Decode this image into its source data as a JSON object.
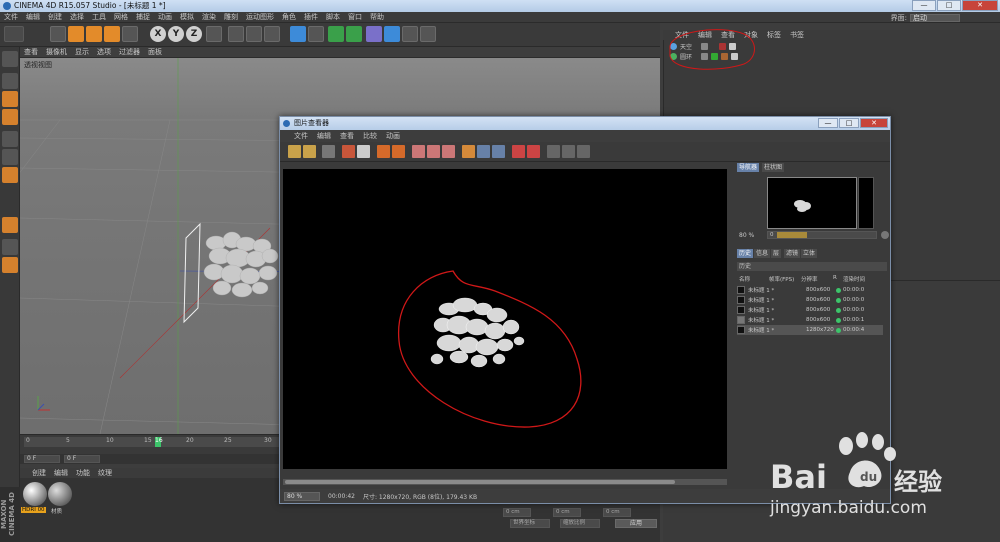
{
  "app": {
    "title": "CINEMA 4D R15.057 Studio - [未标题 1 *]",
    "window_buttons": [
      "—",
      "□",
      "✕"
    ]
  },
  "main_menu": [
    "文件",
    "编辑",
    "创建",
    "选择",
    "工具",
    "网格",
    "捕捉",
    "动画",
    "模拟",
    "渲染",
    "雕刻",
    "运动图形",
    "角色",
    "插件",
    "脚本",
    "窗口",
    "帮助"
  ],
  "layout": {
    "label": "界面:",
    "value": "启动"
  },
  "viewport": {
    "menu": [
      "查看",
      "摄像机",
      "显示",
      "选项",
      "过滤器",
      "面板"
    ],
    "label": "透视视图"
  },
  "timeline": {
    "ticks": [
      "0",
      "5",
      "10",
      "15",
      "16",
      "20",
      "25",
      "30"
    ],
    "current_frame": "16",
    "frame_start": "0 F",
    "frame_field": "0 F"
  },
  "material_manager": {
    "menu": [
      "创建",
      "编辑",
      "功能",
      "纹理"
    ],
    "materials": [
      {
        "label": "HDRI 00",
        "color": "#e8a21c"
      },
      {
        "label": "材质",
        "color": "#9a9a9a"
      }
    ],
    "brand": "MAXON CINEMA 4D"
  },
  "object_manager": {
    "menu": [
      "文件",
      "编辑",
      "查看",
      "对象",
      "标签",
      "书签"
    ],
    "objects": [
      {
        "name": "天空",
        "icon_color": "#5aa0e0"
      },
      {
        "name": "圆环",
        "icon_color": "#4cb060"
      }
    ]
  },
  "attributes": {
    "fields": [
      "0 cm",
      "0 cm",
      "0 cm"
    ],
    "coord_select": "世界坐标",
    "scale_select": "缩放比例",
    "apply": "应用"
  },
  "picture_viewer": {
    "title": "图片查看器",
    "menu": [
      "文件",
      "编辑",
      "查看",
      "比较",
      "动画"
    ],
    "side_tabs_top": [
      "导航器",
      "柱状图"
    ],
    "nav_zoom": "80 %",
    "nav_value": "0",
    "side_tabs_bottom": [
      "历史",
      "信息",
      "层",
      "滤镜",
      "立体"
    ],
    "history_label": "历史",
    "history_columns": [
      "名称",
      "帧率(FPS)",
      "分辨率",
      "R",
      "渲染时间"
    ],
    "history": [
      {
        "name": "未标题 1 *",
        "res": "800x600",
        "time": "00:00:0"
      },
      {
        "name": "未标题 1 *",
        "res": "800x600",
        "time": "00:00:0"
      },
      {
        "name": "未标题 1 *",
        "res": "800x600",
        "time": "00:00:0"
      },
      {
        "name": "未标题 1 *",
        "res": "800x600",
        "time": "00:00:1"
      },
      {
        "name": "未标题 1 *",
        "res": "1280x720",
        "time": "00:00:4"
      }
    ],
    "status_zoom": "80 %",
    "status_time": "00:00:42",
    "status_info": "尺寸: 1280x720, RGB (8位), 179.43 KB"
  },
  "colors": {
    "accent_blue": "#6781a8",
    "annotation_red": "#d01818",
    "progress_green": "#3cc46a"
  },
  "watermark": {
    "brand": "Bai",
    "brand_cn": "经验",
    "url": "jingyan.baidu.com"
  }
}
